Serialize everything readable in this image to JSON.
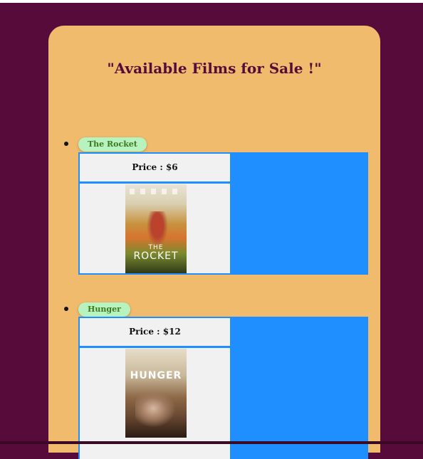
{
  "page": {
    "title": "\"Available Films for Sale !\""
  },
  "films": [
    {
      "name": "The Rocket",
      "price_label": "Price : $6",
      "poster_text": "ROCKET",
      "poster_subtext": "THE"
    },
    {
      "name": "Hunger",
      "price_label": "Price : $12",
      "poster_text": "HUNGER",
      "poster_subtext": ""
    }
  ],
  "colors": {
    "background": "#570b3b",
    "card": "#f0bb6c",
    "badge": "#b7f2bf",
    "badge_text": "#3b7a1f",
    "panel": "#1f8fff"
  }
}
